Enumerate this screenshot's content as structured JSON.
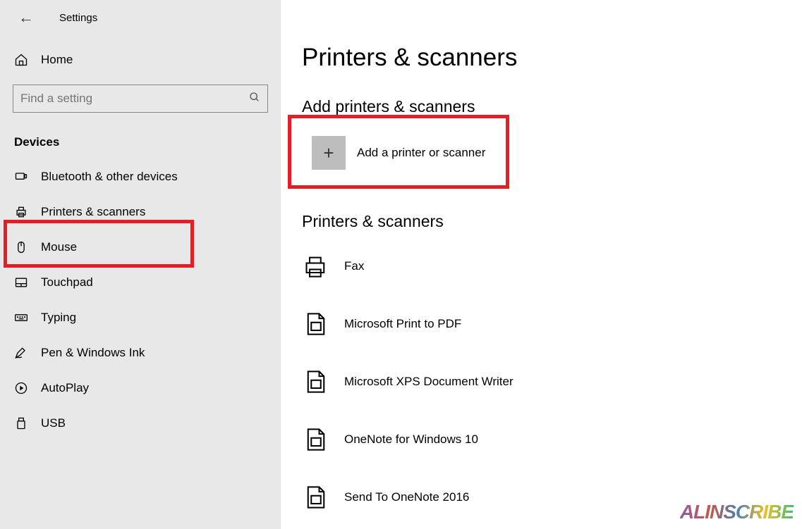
{
  "header": {
    "title": "Settings"
  },
  "sidebar": {
    "home_label": "Home",
    "search_placeholder": "Find a setting",
    "category_label": "Devices",
    "items": [
      {
        "label": "Bluetooth & other devices"
      },
      {
        "label": "Printers & scanners"
      },
      {
        "label": "Mouse"
      },
      {
        "label": "Touchpad"
      },
      {
        "label": "Typing"
      },
      {
        "label": "Pen & Windows Ink"
      },
      {
        "label": "AutoPlay"
      },
      {
        "label": "USB"
      }
    ]
  },
  "main": {
    "page_title": "Printers & scanners",
    "add_section_title": "Add printers & scanners",
    "add_button_label": "Add a printer or scanner",
    "list_section_title": "Printers & scanners",
    "printers": [
      {
        "label": "Fax"
      },
      {
        "label": "Microsoft Print to PDF"
      },
      {
        "label": "Microsoft XPS Document Writer"
      },
      {
        "label": "OneNote for Windows 10"
      },
      {
        "label": "Send To OneNote 2016"
      }
    ]
  },
  "watermark": "ALINSCRIBE"
}
